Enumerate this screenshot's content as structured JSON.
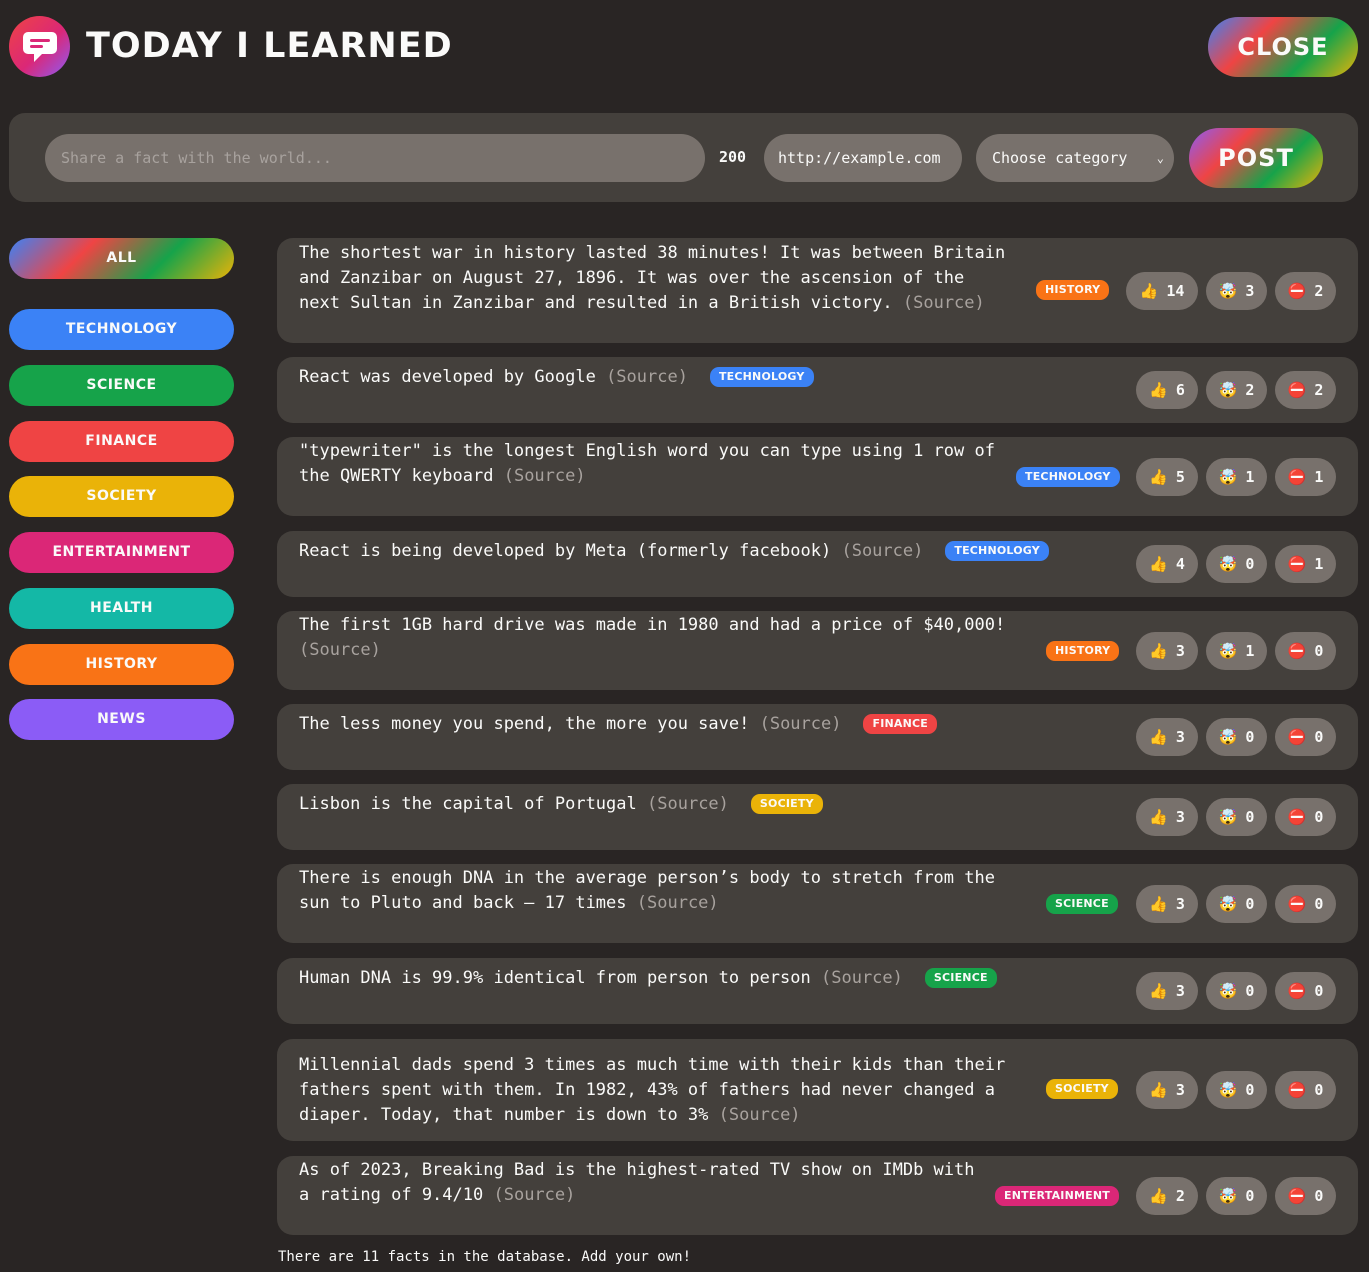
{
  "header": {
    "title": "Today I Learned",
    "close_label": "Close"
  },
  "form": {
    "fact_placeholder": "Share a fact with the world...",
    "char_count": "200",
    "url_placeholder": "http://example.com",
    "category_placeholder": "Choose category",
    "post_label": "Post"
  },
  "categories": [
    {
      "label": "All",
      "color": "gradient"
    },
    {
      "label": "technology",
      "color": "#3b82f6"
    },
    {
      "label": "science",
      "color": "#16a34a"
    },
    {
      "label": "finance",
      "color": "#ef4444"
    },
    {
      "label": "society",
      "color": "#eab308"
    },
    {
      "label": "entertainment",
      "color": "#db2777"
    },
    {
      "label": "health",
      "color": "#14b8a6"
    },
    {
      "label": "history",
      "color": "#f97316"
    },
    {
      "label": "news",
      "color": "#8b5cf6"
    }
  ],
  "facts": [
    {
      "text": "The shortest war in history lasted 38 minutes! It was between Britain and Zanzibar on August 27, 1896. It was over the ascension of the next Sultan in Zanzibar and resulted in a British victory.",
      "source": "(Source)",
      "category": "history",
      "color": "#f97316",
      "likes": "14",
      "mindblowing": "3",
      "false": "2"
    },
    {
      "text": "React was developed by Google",
      "source": "(Source)",
      "category": "technology",
      "color": "#3b82f6",
      "likes": "6",
      "mindblowing": "2",
      "false": "2"
    },
    {
      "text": "\"typewriter\" is the longest English word you can type using 1 row of the QWERTY keyboard",
      "source": "(Source)",
      "category": "technology",
      "color": "#3b82f6",
      "likes": "5",
      "mindblowing": "1",
      "false": "1"
    },
    {
      "text": "React is being developed by Meta (formerly facebook)",
      "source": "(Source)",
      "category": "technology",
      "color": "#3b82f6",
      "likes": "4",
      "mindblowing": "0",
      "false": "1"
    },
    {
      "text": "The first 1GB hard drive was made in 1980 and had a price of $40,000!",
      "source": "(Source)",
      "category": "history",
      "color": "#f97316",
      "likes": "3",
      "mindblowing": "1",
      "false": "0"
    },
    {
      "text": "The less money you spend, the more you save!",
      "source": "(Source)",
      "category": "finance",
      "color": "#ef4444",
      "likes": "3",
      "mindblowing": "0",
      "false": "0"
    },
    {
      "text": "Lisbon is the capital of Portugal",
      "source": "(Source)",
      "category": "society",
      "color": "#eab308",
      "likes": "3",
      "mindblowing": "0",
      "false": "0"
    },
    {
      "text": "There is enough DNA in the average person’s body to stretch from the sun to Pluto and back — 17 times",
      "source": "(Source)",
      "category": "science",
      "color": "#16a34a",
      "likes": "3",
      "mindblowing": "0",
      "false": "0"
    },
    {
      "text": "Human DNA is 99.9% identical from person to person",
      "source": "(Source)",
      "category": "science",
      "color": "#16a34a",
      "likes": "3",
      "mindblowing": "0",
      "false": "0"
    },
    {
      "text": "Millennial dads spend 3 times as much time with their kids than their fathers spent with them. In 1982, 43% of fathers had never changed a diaper. Today, that number is down to 3%",
      "source": "(Source)",
      "category": "society",
      "color": "#eab308",
      "likes": "3",
      "mindblowing": "0",
      "false": "0"
    },
    {
      "text": "As of 2023, Breaking Bad is the highest-rated TV show on IMDb with a rating of 9.4/10",
      "source": "(Source)",
      "category": "entertainment",
      "color": "#db2777",
      "likes": "2",
      "mindblowing": "0",
      "false": "0"
    }
  ],
  "vote_icons": {
    "like": "👍",
    "mindblowing": "🤯",
    "false": "⛔️"
  },
  "footer": "There are 11 facts in the database. Add your own!"
}
